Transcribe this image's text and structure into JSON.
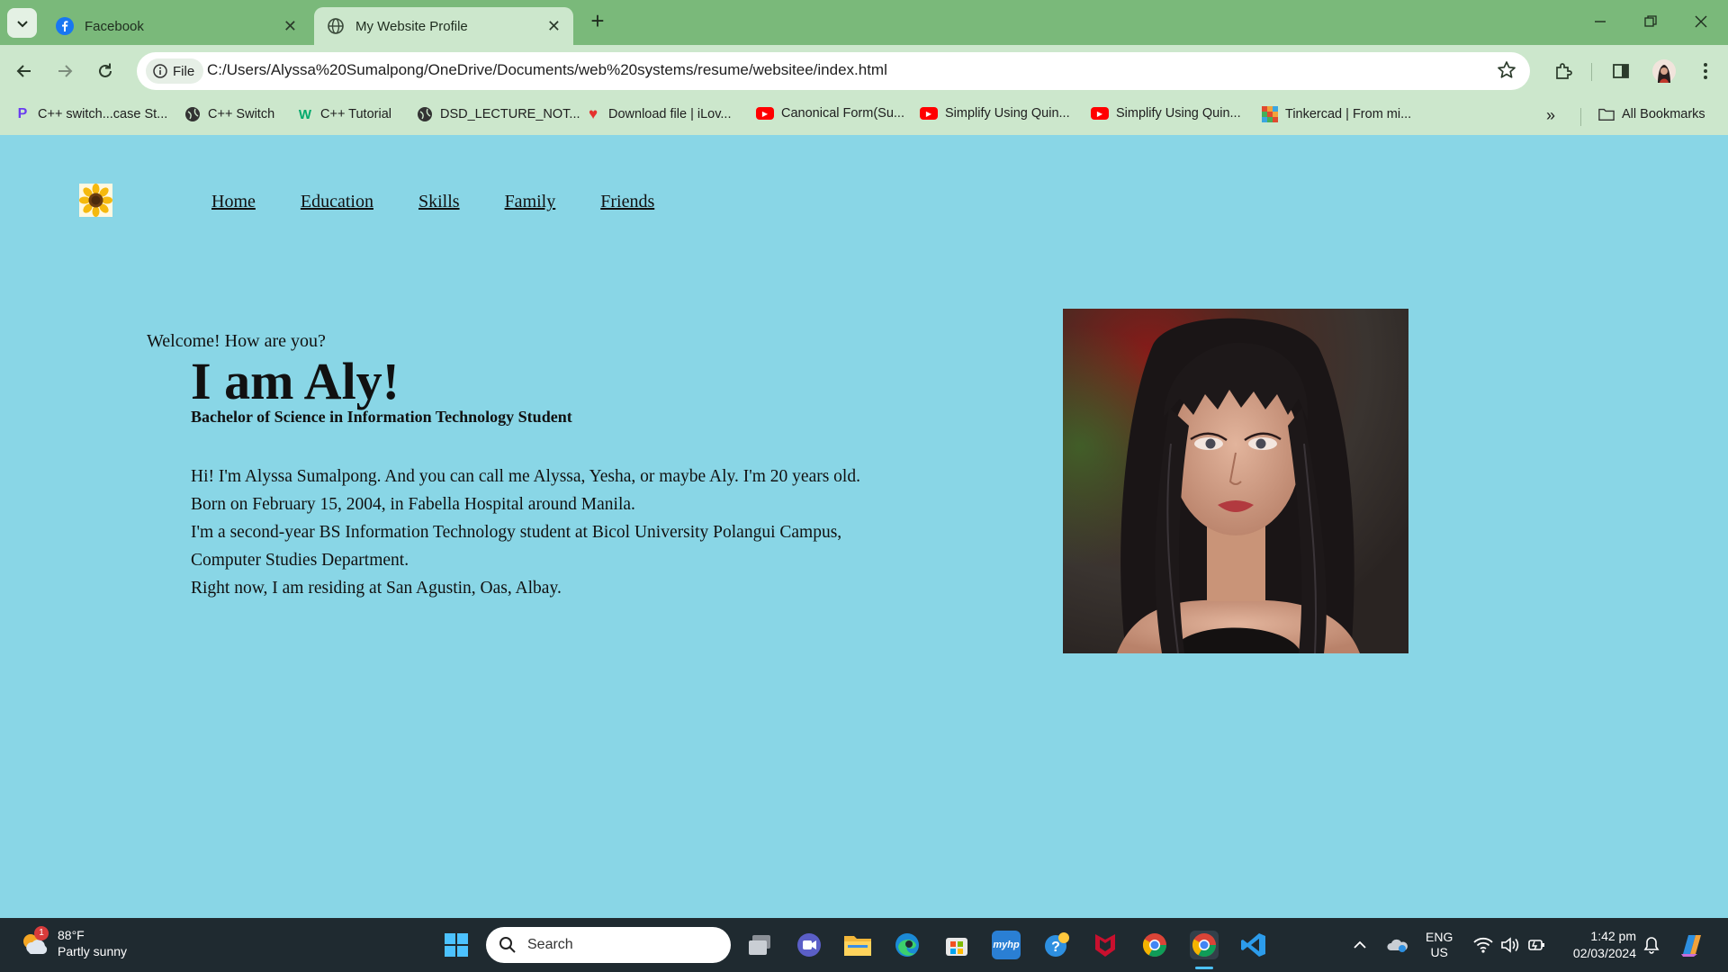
{
  "browser": {
    "tabs": [
      {
        "title": "Facebook",
        "icon": "facebook-icon",
        "active": false
      },
      {
        "title": "My Website Profile",
        "icon": "globe-icon",
        "active": true
      }
    ],
    "address_chip": "File",
    "url": "C:/Users/Alyssa%20Sumalpong/OneDrive/Documents/web%20systems/resume/websitee/index.html",
    "bookmarks": [
      {
        "label": "C++ switch...case St...",
        "icon": "p-logo-icon",
        "color": "#6a3df0"
      },
      {
        "label": "C++ Switch",
        "icon": "globe-icon",
        "color": "#333333"
      },
      {
        "label": "C++ Tutorial",
        "icon": "w3schools-icon",
        "color": "#04aa6d"
      },
      {
        "label": "DSD_LECTURE_NOT...",
        "icon": "globe-icon",
        "color": "#333333"
      },
      {
        "label": "Download file | iLov...",
        "icon": "heart-icon",
        "color": "#e5322d"
      },
      {
        "label": "Canonical Form(Su...",
        "icon": "youtube-icon",
        "color": "#ff0000"
      },
      {
        "label": "Simplify Using Quin...",
        "icon": "youtube-icon",
        "color": "#ff0000"
      },
      {
        "label": "Simplify Using Quin...",
        "icon": "youtube-icon",
        "color": "#ff0000"
      },
      {
        "label": "Tinkercad | From mi...",
        "icon": "tinkercad-icon",
        "color": "#e04a2f"
      }
    ],
    "all_bookmarks": "All Bookmarks"
  },
  "page": {
    "nav": [
      "Home",
      "Education",
      "Skills",
      "Family",
      "Friends"
    ],
    "welcome": "Welcome! How are you?",
    "title": "I am Aly!",
    "subtitle": "Bachelor of Science in Information Technology Student",
    "bio": [
      "Hi! I'm Alyssa Sumalpong. And you can call me Alyssa, Yesha, or maybe Aly. I'm 20 years old.",
      "Born on February 15, 2004, in Fabella Hospital around Manila.",
      "I'm a second-year BS Information Technology student at Bicol University Polangui Campus,",
      "Computer Studies Department.",
      "Right now, I am residing at San Agustin, Oas, Albay."
    ],
    "background_color": "#89d6e6"
  },
  "taskbar": {
    "weather_temp": "88°F",
    "weather_desc": "Partly sunny",
    "weather_badge": "1",
    "search_placeholder": "Search",
    "lang_top": "ENG",
    "lang_bottom": "US",
    "time": "1:42 pm",
    "date": "02/03/2024"
  }
}
